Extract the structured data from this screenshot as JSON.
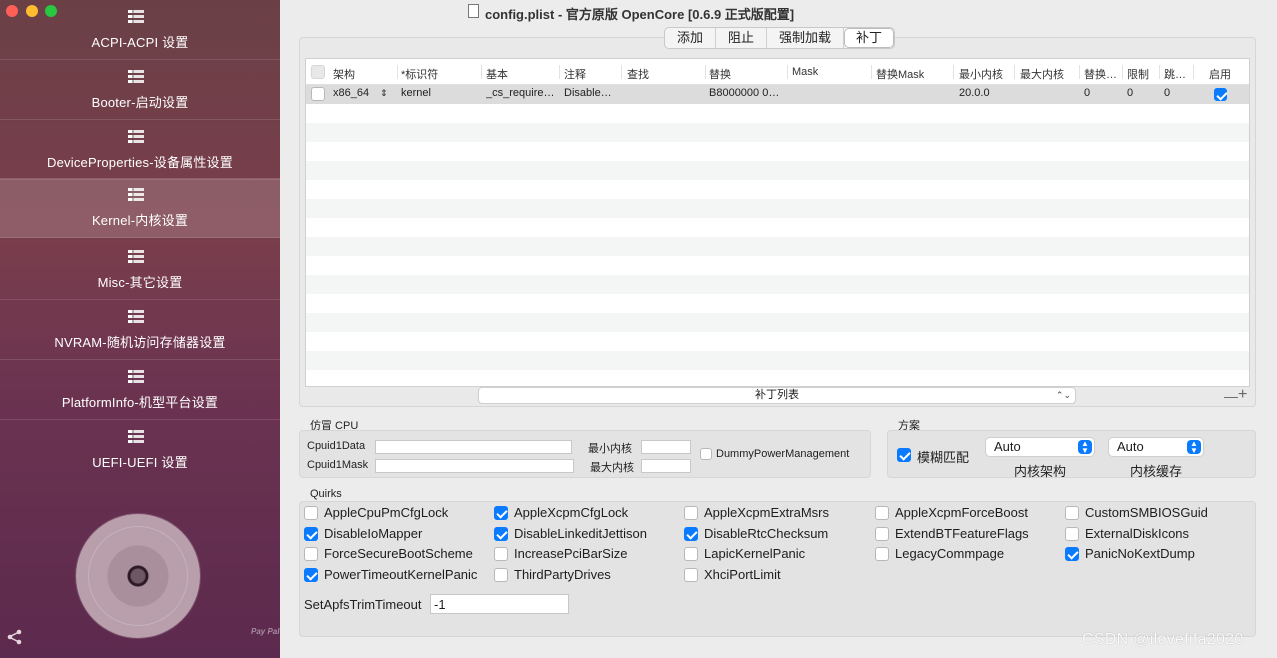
{
  "window": {
    "title": "config.plist - 官方原版 OpenCore [0.6.9 正式版配置]"
  },
  "sidebar": {
    "items": [
      {
        "label": "ACPI-ACPI 设置"
      },
      {
        "label": "Booter-启动设置"
      },
      {
        "label": "DeviceProperties-设备属性设置"
      },
      {
        "label": "Kernel-内核设置",
        "active": true
      },
      {
        "label": "Misc-其它设置"
      },
      {
        "label": "NVRAM-随机访问存储器设置"
      },
      {
        "label": "PlatformInfo-机型平台设置"
      },
      {
        "label": "UEFI-UEFI 设置"
      }
    ],
    "paypal": "Pay Pal"
  },
  "tabs": [
    {
      "label": "添加"
    },
    {
      "label": "阻止"
    },
    {
      "label": "强制加载"
    },
    {
      "label": "补丁",
      "selected": true
    }
  ],
  "table": {
    "columns": [
      "架构",
      "*标识符",
      "基本",
      "注释",
      "查找",
      "替换",
      "Mask",
      "替换Mask",
      "最小内核",
      "最大内核",
      "替换…",
      "限制",
      "跳…",
      "启用"
    ],
    "rows": [
      {
        "checked": false,
        "arch": "x86_64",
        "identifier": "kernel",
        "base": "_cs_require…",
        "comment": "Disable…",
        "find": "",
        "replace": "B8000000 0…",
        "mask": "",
        "replace_mask": "",
        "min_kernel": "20.0.0",
        "max_kernel": "",
        "count": "0",
        "limit": "0",
        "skip": "0",
        "enabled": true
      }
    ],
    "list_popup": "补丁列表",
    "minus": "—",
    "plus": "+"
  },
  "emulate": {
    "title": "仿冒 CPU",
    "cpuid1data_label": "Cpuid1Data",
    "cpuid1mask_label": "Cpuid1Mask",
    "cpuid1data_value": "",
    "cpuid1mask_value": "",
    "min_kernel_label": "最小内核",
    "max_kernel_label": "最大内核",
    "min_kernel_value": "",
    "max_kernel_value": "",
    "dummy_pm_label": "DummyPowerManagement",
    "dummy_pm_checked": false
  },
  "scheme": {
    "title": "方案",
    "fuzzy_label": "模糊匹配",
    "fuzzy_checked": true,
    "kernel_arch_value": "Auto",
    "kernel_arch_label": "内核架构",
    "kernel_cache_value": "Auto",
    "kernel_cache_label": "内核缓存"
  },
  "quirks": {
    "title": "Quirks",
    "items": [
      {
        "label": "AppleCpuPmCfgLock",
        "checked": false
      },
      {
        "label": "AppleXcpmCfgLock",
        "checked": true
      },
      {
        "label": "AppleXcpmExtraMsrs",
        "checked": false
      },
      {
        "label": "AppleXcpmForceBoost",
        "checked": false
      },
      {
        "label": "CustomSMBIOSGuid",
        "checked": false
      },
      {
        "label": "DisableIoMapper",
        "checked": true
      },
      {
        "label": "DisableLinkeditJettison",
        "checked": true
      },
      {
        "label": "DisableRtcChecksum",
        "checked": true
      },
      {
        "label": "ExtendBTFeatureFlags",
        "checked": false
      },
      {
        "label": "ExternalDiskIcons",
        "checked": false
      },
      {
        "label": "ForceSecureBootScheme",
        "checked": false
      },
      {
        "label": "IncreasePciBarSize",
        "checked": false
      },
      {
        "label": "LapicKernelPanic",
        "checked": false
      },
      {
        "label": "LegacyCommpage",
        "checked": false
      },
      {
        "label": "PanicNoKextDump",
        "checked": true
      },
      {
        "label": "PowerTimeoutKernelPanic",
        "checked": true
      },
      {
        "label": "ThirdPartyDrives",
        "checked": false
      },
      {
        "label": "XhciPortLimit",
        "checked": false
      }
    ],
    "apfs_trim_label": "SetApfsTrimTimeout",
    "apfs_trim_value": "-1"
  },
  "watermark": "CSDN @ilovefifa2020",
  "colors": {
    "accent": "#0a7aff",
    "sidebar_top": "#6a4046",
    "sidebar_bottom": "#5c2a4e"
  }
}
